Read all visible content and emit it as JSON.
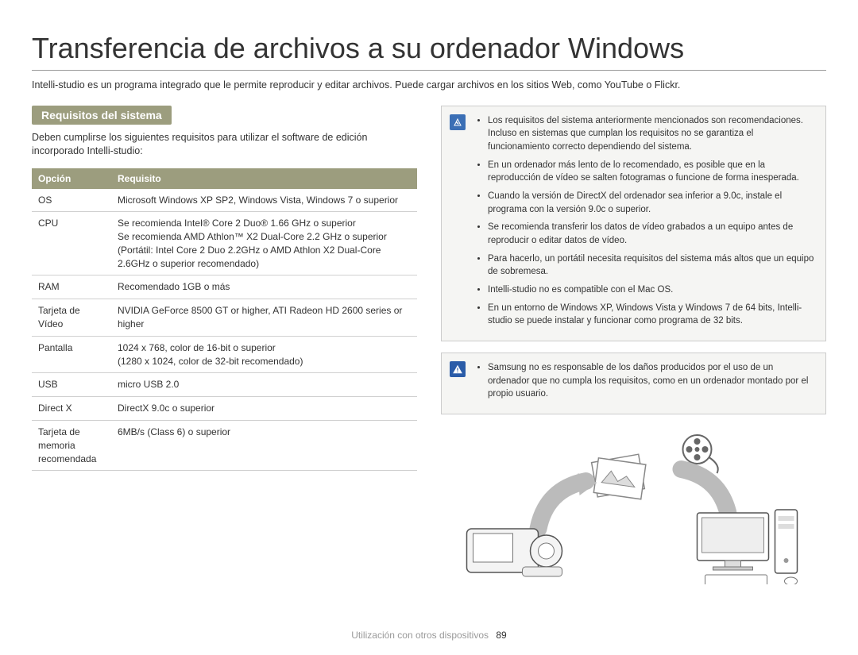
{
  "title": "Transferencia de archivos a su ordenador Windows",
  "intro": "Intelli-studio es un programa integrado que le permite reproducir y editar archivos. Puede cargar archivos en los sitios Web, como YouTube o Flickr.",
  "section": {
    "heading": "Requisitos del sistema",
    "text": "Deben cumplirse los siguientes requisitos para utilizar el software de edición incorporado Intelli-studio:"
  },
  "table": {
    "head_option": "Opción",
    "head_req": "Requisito",
    "rows": [
      {
        "option": "OS",
        "req": "Microsoft Windows XP SP2, Windows Vista, Windows 7 o superior"
      },
      {
        "option": "CPU",
        "req": "Se recomienda Intel® Core 2 Duo® 1.66 GHz o superior\nSe recomienda AMD Athlon™ X2 Dual-Core 2.2 GHz o superior\n(Portátil: Intel Core 2 Duo 2.2GHz o AMD Athlon X2 Dual-Core 2.6GHz o superior recomendado)"
      },
      {
        "option": "RAM",
        "req": "Recomendado 1GB o más"
      },
      {
        "option": "Tarjeta de Vídeo",
        "req": "NVIDIA GeForce 8500 GT or higher, ATI Radeon HD 2600 series or higher"
      },
      {
        "option": "Pantalla",
        "req": "1024 x 768, color de 16-bit o superior\n(1280 x 1024, color de 32-bit recomendado)"
      },
      {
        "option": "USB",
        "req": "micro USB 2.0"
      },
      {
        "option": "Direct X",
        "req": "DirectX 9.0c o superior"
      },
      {
        "option": "Tarjeta de memoria recomendada",
        "req": "6MB/s (Class 6) o superior"
      }
    ]
  },
  "notes1": [
    "Los requisitos del sistema anteriormente mencionados son recomendaciones. Incluso en sistemas que cumplan los requisitos no se garantiza el funcionamiento correcto dependiendo del sistema.",
    "En un ordenador más lento de lo recomendado, es posible que en la reproducción de vídeo se salten fotogramas o funcione de forma inesperada.",
    "Cuando la versión de DirectX del ordenador sea inferior a 9.0c, instale el programa con la versión 9.0c o superior.",
    "Se recomienda transferir los datos de vídeo grabados a un equipo antes de reproducir o editar datos de vídeo.",
    "Para hacerlo, un portátil necesita requisitos del sistema más altos que un equipo de sobremesa.",
    "Intelli-studio no es compatible con el Mac OS.",
    "En un entorno de Windows XP, Windows Vista y Windows 7 de 64 bits, Intelli-studio se puede instalar y funcionar como programa de 32 bits."
  ],
  "notes2": [
    "Samsung no es responsable de los daños producidos por el uso de un ordenador que no cumpla los requisitos, como en un ordenador montado por el propio usuario."
  ],
  "footer": {
    "section": "Utilización con otros dispositivos",
    "page": "89"
  }
}
